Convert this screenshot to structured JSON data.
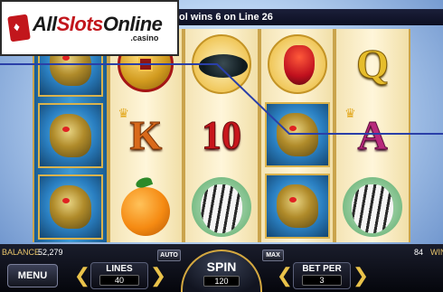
{
  "logo": {
    "brand_all": "All",
    "brand_slots": "Slots",
    "brand_online": "Online",
    "casino": ".casino"
  },
  "message": {
    "text": "ol  wins 6 on Line 26"
  },
  "reels": [
    [
      "dragon",
      "dragon",
      "dragon"
    ],
    [
      "coin",
      "K",
      "orange"
    ],
    [
      "tortoise",
      "10",
      "tiger"
    ],
    [
      "phoenix",
      "dragon",
      "dragon"
    ],
    [
      "Q",
      "A",
      "tiger"
    ]
  ],
  "symbols": {
    "K": "K",
    "ten": "10",
    "Q": "Q",
    "A": "A"
  },
  "status": {
    "balance_label": "BALANCE",
    "balance_value": "52,279",
    "win_value": "84",
    "win_label": "WIN"
  },
  "controls": {
    "menu_label": "MENU",
    "auto_label": "AUTO",
    "max_label": "MAX",
    "lines_label": "LINES",
    "lines_value": "40",
    "spin_label": "SPIN",
    "spin_value": "120",
    "bet_label": "BET PER",
    "bet_value": "3",
    "arrow_left": "❮",
    "arrow_right": "❯"
  },
  "colors": {
    "winline": "#2a3fa8",
    "gold": "#d4a840"
  }
}
